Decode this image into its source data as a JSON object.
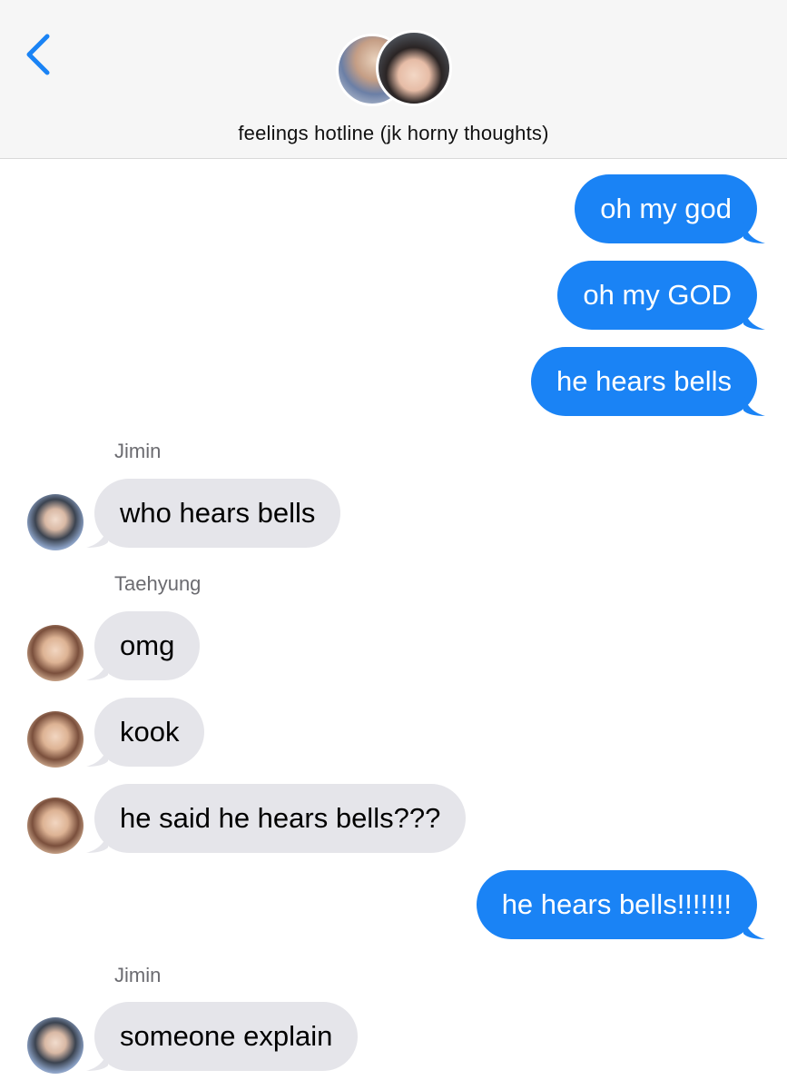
{
  "header": {
    "back_icon": "chevron-left-icon",
    "group_name": "feelings hotline (jk horny thoughts)",
    "accent_color": "#1a83f5"
  },
  "messages": [
    {
      "type": "sent",
      "text": "oh my god"
    },
    {
      "type": "sent",
      "text": "oh my GOD"
    },
    {
      "type": "sent",
      "text": "he hears bells"
    },
    {
      "type": "sender",
      "text": "Jimin"
    },
    {
      "type": "received",
      "sender": "Jimin",
      "text": "who hears bells"
    },
    {
      "type": "sender",
      "text": "Taehyung"
    },
    {
      "type": "received",
      "sender": "Taehyung",
      "text": "omg"
    },
    {
      "type": "received",
      "sender": "Taehyung",
      "text": "kook"
    },
    {
      "type": "received",
      "sender": "Taehyung",
      "text": "he said he hears bells???"
    },
    {
      "type": "sent",
      "text": "he hears bells!!!!!!!"
    },
    {
      "type": "sender",
      "text": "Jimin"
    },
    {
      "type": "received",
      "sender": "Jimin",
      "text": "someone explain"
    }
  ],
  "colors": {
    "sent_bubble": "#1a83f5",
    "received_bubble": "#e5e5ea",
    "header_bg": "#f6f6f6"
  }
}
